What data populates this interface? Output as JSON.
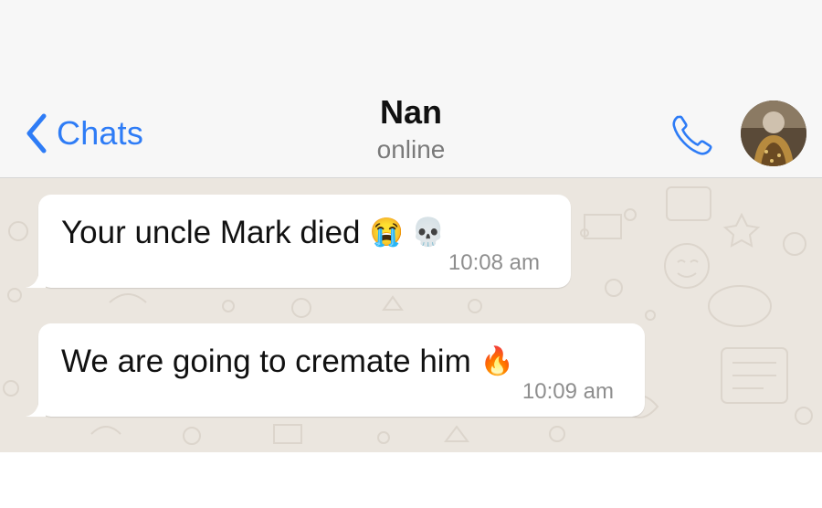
{
  "header": {
    "back_label": "Chats",
    "contact_name": "Nan",
    "status": "online",
    "call_icon": "phone-icon",
    "avatar_icon": "contact-avatar"
  },
  "messages": [
    {
      "text": "Your uncle Mark died",
      "emojis": "😭 💀",
      "time": "10:08 am"
    },
    {
      "text": "We are going to cremate him",
      "emojis": "🔥",
      "time": "10:09 am"
    }
  ],
  "colors": {
    "accent": "#2e7cf6",
    "chat_background": "#ebe6df",
    "header_background": "#f7f7f7",
    "bubble": "#ffffff"
  }
}
